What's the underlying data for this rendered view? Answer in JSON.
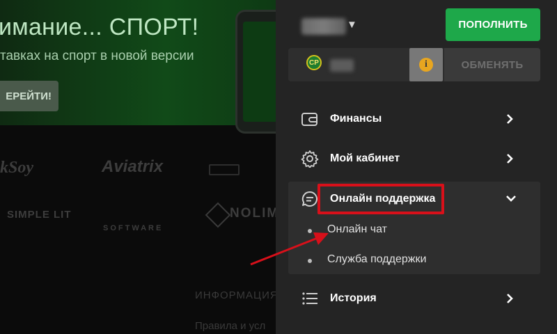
{
  "background": {
    "promo": {
      "title": "имание... СПОРТ!",
      "subtitle": "тавках на спорт в новой версии",
      "button_label": "ЕРЕЙТИ!"
    },
    "providers": [
      "kSoy",
      "Aviatrix",
      "SIMPLE LIT",
      "SOFTWARE",
      "NOLIM"
    ],
    "info_heading": "ИНФОРМАЦИЯ",
    "rules_link": "Правила и усл"
  },
  "panel": {
    "balance_caret": "▼",
    "deposit_label": "ПОПОЛНИТЬ",
    "cp_badge": "CP",
    "info_symbol": "i",
    "exchange_label": "ОБМЕНЯТЬ",
    "menu": {
      "finance": "Финансы",
      "cabinet": "Мой кабинет",
      "history": "История"
    },
    "support": {
      "label": "Онлайн поддержка",
      "items": [
        "Онлайн чат",
        "Служба поддержки"
      ]
    }
  },
  "colors": {
    "accent_green": "#1ea84a",
    "highlight_red": "#d8101a",
    "info_orange": "#e8a620",
    "panel_bg": "#242424"
  }
}
